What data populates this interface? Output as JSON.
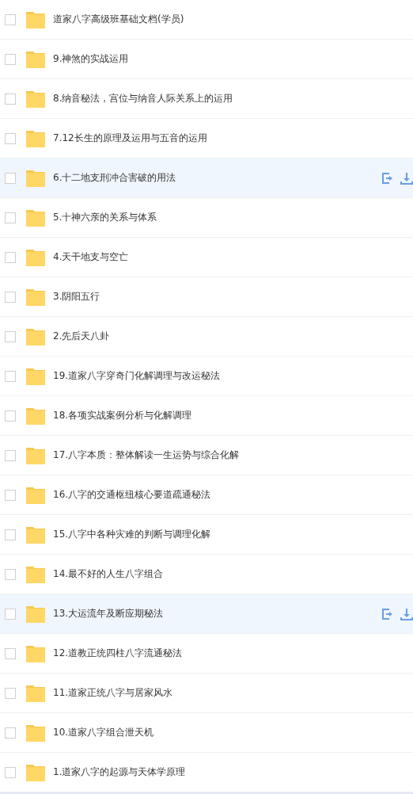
{
  "files": [
    {
      "name": "道家八字高级班基础文档(学员)",
      "highlighted": false,
      "checked": false
    },
    {
      "name": "9.神煞的实战运用",
      "highlighted": false,
      "checked": false
    },
    {
      "name": "8.纳音秘法，宫位与纳音人际关系上的运用",
      "highlighted": false,
      "checked": false
    },
    {
      "name": "7.12长生的原理及运用与五音的运用",
      "highlighted": false,
      "checked": false
    },
    {
      "name": "6.十二地支刑冲合害破的用法",
      "highlighted": true,
      "checked": false
    },
    {
      "name": "5.十神六亲的关系与体系",
      "highlighted": false,
      "checked": false
    },
    {
      "name": "4.天干地支与空亡",
      "highlighted": false,
      "checked": false
    },
    {
      "name": "3.阴阳五行",
      "highlighted": false,
      "checked": false
    },
    {
      "name": "2.先后天八卦",
      "highlighted": false,
      "checked": false
    },
    {
      "name": "19.道家八字穿奇门化解调理与改运秘法",
      "highlighted": false,
      "checked": false
    },
    {
      "name": "18.各项实战案例分析与化解调理",
      "highlighted": false,
      "checked": false
    },
    {
      "name": "17.八字本质：整体解读一生运势与综合化解",
      "highlighted": false,
      "checked": false
    },
    {
      "name": "16.八字的交通枢纽核心要道疏通秘法",
      "highlighted": false,
      "checked": false
    },
    {
      "name": "15.八字中各种灾难的判断与调理化解",
      "highlighted": false,
      "checked": false
    },
    {
      "name": "14.最不好的人生八字组合",
      "highlighted": false,
      "checked": false
    },
    {
      "name": "13.大运流年及断应期秘法",
      "highlighted": true,
      "checked": false
    },
    {
      "name": "12.道教正统四柱八字流通秘法",
      "highlighted": false,
      "checked": false
    },
    {
      "name": "11.道家正统八字与居家风水",
      "highlighted": false,
      "checked": false
    },
    {
      "name": "10.道家八字组合泄天机",
      "highlighted": false,
      "checked": false
    },
    {
      "name": "1.道家八字的起源与天体学原理",
      "highlighted": false,
      "checked": false
    }
  ]
}
